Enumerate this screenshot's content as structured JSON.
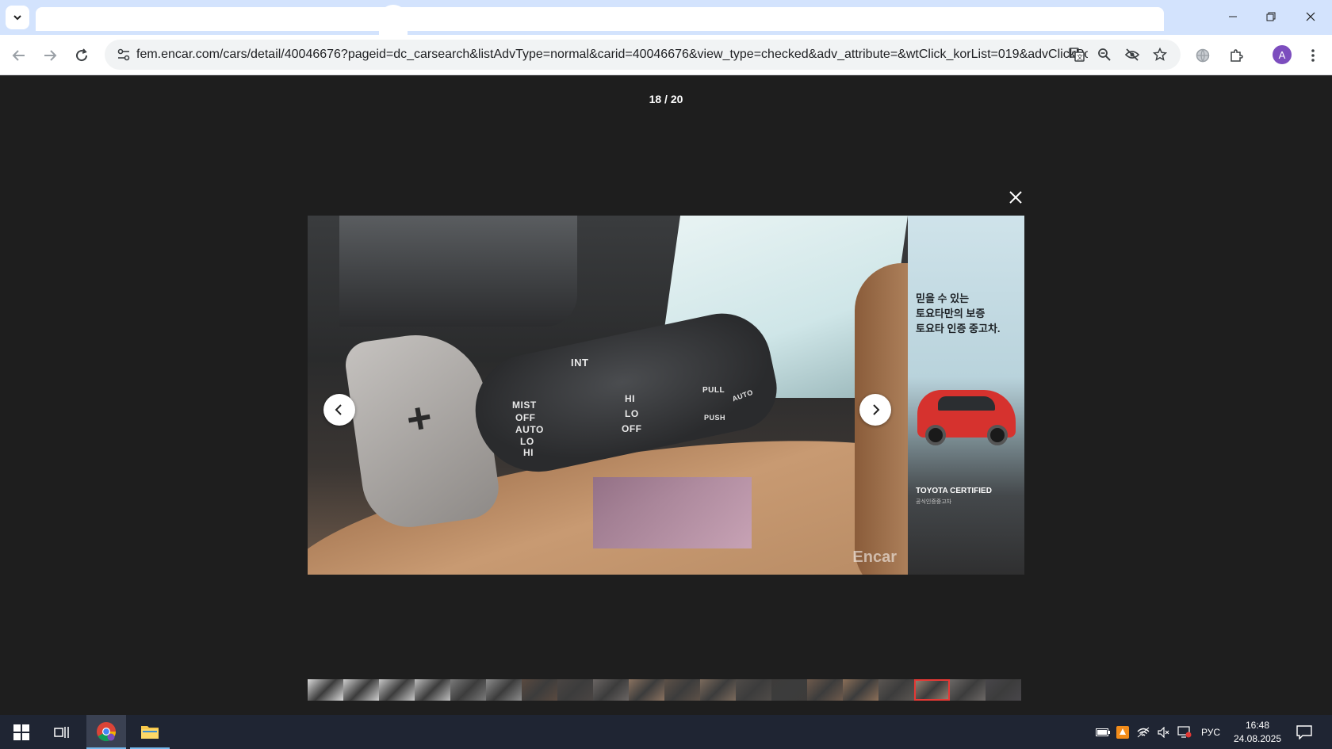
{
  "browser": {
    "url": "fem.encar.com/cars/detail/40046676?pageid=dc_carsearch&listAdvType=normal&carid=40046676&view_type=checked&adv_attribute=&wtClick_korList=019&advClickPo...",
    "profile_initial": "A"
  },
  "viewer": {
    "counter": "18 / 20",
    "photo_labels": {
      "int": "INT",
      "mist": "MIST",
      "off": "OFF",
      "auto": "AUTO",
      "lo": "LO",
      "hi": "HI",
      "hi2": "HI",
      "lo2": "LO",
      "off2": "OFF",
      "pull": "PULL",
      "push": "PUSH",
      "auto2": "AUTO"
    },
    "watermark": "Encar",
    "thumbnail_count": 20,
    "active_thumbnail": 18
  },
  "ad": {
    "line1": "믿을 수 있는",
    "line2": "토요타만의 보증",
    "line3": "토요타 인증 중고차.",
    "brand": "TOYOTA CERTIFIED",
    "subbrand": "공식인증중고차"
  },
  "taskbar": {
    "language": "РУС",
    "time": "16:48",
    "date": "24.08.2025"
  },
  "colors": {
    "accent": "#7c4dbe",
    "thumb_active": "#e53935",
    "taskbar": "#1f2533"
  }
}
